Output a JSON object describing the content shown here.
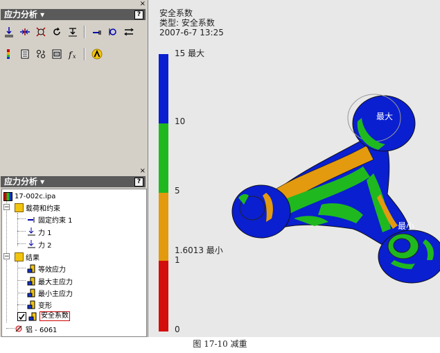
{
  "top_panel": {
    "close": "×",
    "title": "应力分析 ▾",
    "help": "?"
  },
  "bottom_panel": {
    "close": "×",
    "title": "应力分析 ▾",
    "help": "?"
  },
  "tree": {
    "root": "17-002c.ipa",
    "loads": "载荷和约束",
    "constraint": "固定约束 1",
    "force1": "力 1",
    "force2": "力 2",
    "results": "结果",
    "r1": "等效应力",
    "r2": "最大主应力",
    "r3": "最小主应力",
    "r4": "变形",
    "r5": "安全系数",
    "material": "铝 - 6061"
  },
  "result_header": {
    "line1": "安全系数",
    "line2": "类型: 安全系数",
    "line3": "2007-6-7 13:25"
  },
  "legend": {
    "max_label": "15 最大",
    "l10": "10",
    "l5": "5",
    "min_label": "1.6013 最小",
    "l1": "1",
    "l0": "0",
    "colors": {
      "blue": "#0a1fcf",
      "green": "#1fb91f",
      "orange": "#e39a0e",
      "red": "#d40d0d"
    }
  },
  "model_labels": {
    "max": "最大",
    "min": "最小"
  },
  "caption": "图 17-10  减重"
}
